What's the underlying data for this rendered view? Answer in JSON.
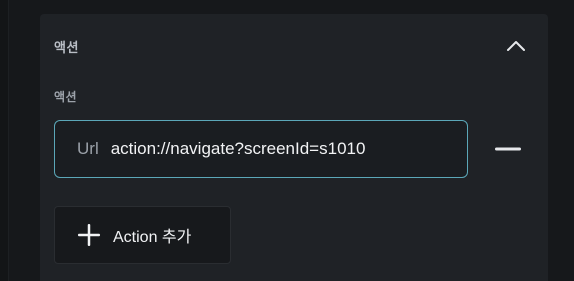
{
  "section": {
    "title": "액션",
    "collapse_icon": "chevron-up-icon"
  },
  "action_field": {
    "label": "액션",
    "type": "Url",
    "value": "action://navigate?screenId=s1010",
    "remove_icon": "minus-icon"
  },
  "add_button": {
    "label": "Action 추가",
    "icon": "plus-icon"
  },
  "colors": {
    "background": "#16181b",
    "panel": "#1f2226",
    "field_border": "#5ba7b8",
    "text_primary": "#f2f3f5",
    "text_secondary": "#9aa0a8"
  }
}
